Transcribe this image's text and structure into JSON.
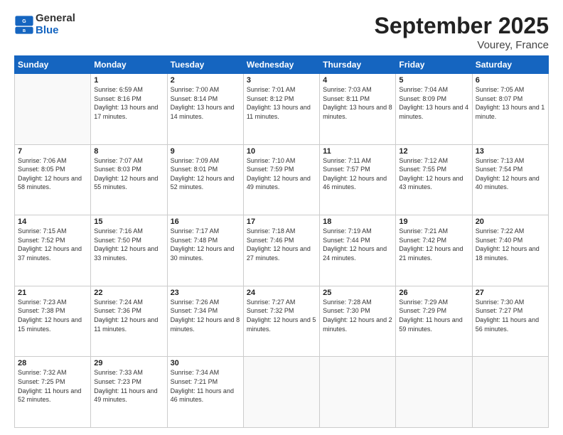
{
  "header": {
    "logo_general": "General",
    "logo_blue": "Blue",
    "title": "September 2025",
    "location": "Vourey, France"
  },
  "weekdays": [
    "Sunday",
    "Monday",
    "Tuesday",
    "Wednesday",
    "Thursday",
    "Friday",
    "Saturday"
  ],
  "weeks": [
    [
      {
        "day": "",
        "info": ""
      },
      {
        "day": "1",
        "info": "Sunrise: 6:59 AM\nSunset: 8:16 PM\nDaylight: 13 hours\nand 17 minutes."
      },
      {
        "day": "2",
        "info": "Sunrise: 7:00 AM\nSunset: 8:14 PM\nDaylight: 13 hours\nand 14 minutes."
      },
      {
        "day": "3",
        "info": "Sunrise: 7:01 AM\nSunset: 8:12 PM\nDaylight: 13 hours\nand 11 minutes."
      },
      {
        "day": "4",
        "info": "Sunrise: 7:03 AM\nSunset: 8:11 PM\nDaylight: 13 hours\nand 8 minutes."
      },
      {
        "day": "5",
        "info": "Sunrise: 7:04 AM\nSunset: 8:09 PM\nDaylight: 13 hours\nand 4 minutes."
      },
      {
        "day": "6",
        "info": "Sunrise: 7:05 AM\nSunset: 8:07 PM\nDaylight: 13 hours\nand 1 minute."
      }
    ],
    [
      {
        "day": "7",
        "info": "Sunrise: 7:06 AM\nSunset: 8:05 PM\nDaylight: 12 hours\nand 58 minutes."
      },
      {
        "day": "8",
        "info": "Sunrise: 7:07 AM\nSunset: 8:03 PM\nDaylight: 12 hours\nand 55 minutes."
      },
      {
        "day": "9",
        "info": "Sunrise: 7:09 AM\nSunset: 8:01 PM\nDaylight: 12 hours\nand 52 minutes."
      },
      {
        "day": "10",
        "info": "Sunrise: 7:10 AM\nSunset: 7:59 PM\nDaylight: 12 hours\nand 49 minutes."
      },
      {
        "day": "11",
        "info": "Sunrise: 7:11 AM\nSunset: 7:57 PM\nDaylight: 12 hours\nand 46 minutes."
      },
      {
        "day": "12",
        "info": "Sunrise: 7:12 AM\nSunset: 7:55 PM\nDaylight: 12 hours\nand 43 minutes."
      },
      {
        "day": "13",
        "info": "Sunrise: 7:13 AM\nSunset: 7:54 PM\nDaylight: 12 hours\nand 40 minutes."
      }
    ],
    [
      {
        "day": "14",
        "info": "Sunrise: 7:15 AM\nSunset: 7:52 PM\nDaylight: 12 hours\nand 37 minutes."
      },
      {
        "day": "15",
        "info": "Sunrise: 7:16 AM\nSunset: 7:50 PM\nDaylight: 12 hours\nand 33 minutes."
      },
      {
        "day": "16",
        "info": "Sunrise: 7:17 AM\nSunset: 7:48 PM\nDaylight: 12 hours\nand 30 minutes."
      },
      {
        "day": "17",
        "info": "Sunrise: 7:18 AM\nSunset: 7:46 PM\nDaylight: 12 hours\nand 27 minutes."
      },
      {
        "day": "18",
        "info": "Sunrise: 7:19 AM\nSunset: 7:44 PM\nDaylight: 12 hours\nand 24 minutes."
      },
      {
        "day": "19",
        "info": "Sunrise: 7:21 AM\nSunset: 7:42 PM\nDaylight: 12 hours\nand 21 minutes."
      },
      {
        "day": "20",
        "info": "Sunrise: 7:22 AM\nSunset: 7:40 PM\nDaylight: 12 hours\nand 18 minutes."
      }
    ],
    [
      {
        "day": "21",
        "info": "Sunrise: 7:23 AM\nSunset: 7:38 PM\nDaylight: 12 hours\nand 15 minutes."
      },
      {
        "day": "22",
        "info": "Sunrise: 7:24 AM\nSunset: 7:36 PM\nDaylight: 12 hours\nand 11 minutes."
      },
      {
        "day": "23",
        "info": "Sunrise: 7:26 AM\nSunset: 7:34 PM\nDaylight: 12 hours\nand 8 minutes."
      },
      {
        "day": "24",
        "info": "Sunrise: 7:27 AM\nSunset: 7:32 PM\nDaylight: 12 hours\nand 5 minutes."
      },
      {
        "day": "25",
        "info": "Sunrise: 7:28 AM\nSunset: 7:30 PM\nDaylight: 12 hours\nand 2 minutes."
      },
      {
        "day": "26",
        "info": "Sunrise: 7:29 AM\nSunset: 7:29 PM\nDaylight: 11 hours\nand 59 minutes."
      },
      {
        "day": "27",
        "info": "Sunrise: 7:30 AM\nSunset: 7:27 PM\nDaylight: 11 hours\nand 56 minutes."
      }
    ],
    [
      {
        "day": "28",
        "info": "Sunrise: 7:32 AM\nSunset: 7:25 PM\nDaylight: 11 hours\nand 52 minutes."
      },
      {
        "day": "29",
        "info": "Sunrise: 7:33 AM\nSunset: 7:23 PM\nDaylight: 11 hours\nand 49 minutes."
      },
      {
        "day": "30",
        "info": "Sunrise: 7:34 AM\nSunset: 7:21 PM\nDaylight: 11 hours\nand 46 minutes."
      },
      {
        "day": "",
        "info": ""
      },
      {
        "day": "",
        "info": ""
      },
      {
        "day": "",
        "info": ""
      },
      {
        "day": "",
        "info": ""
      }
    ]
  ]
}
